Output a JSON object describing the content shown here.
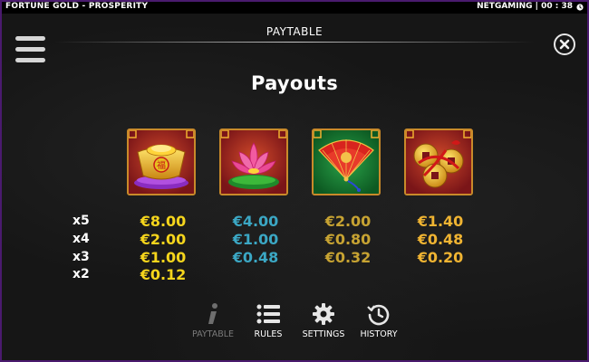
{
  "topbar": {
    "title": "FORTUNE GOLD - PROSPERITY",
    "brand_time": "NETGAMING | 00 : 38"
  },
  "header": {
    "title": "PAYTABLE"
  },
  "page": {
    "heading": "Payouts"
  },
  "symbols": [
    {
      "name": "gold-ingot",
      "char": "福"
    },
    {
      "name": "lotus"
    },
    {
      "name": "fan"
    },
    {
      "name": "coins"
    }
  ],
  "multipliers": [
    "x5",
    "x4",
    "x3",
    "x2"
  ],
  "payouts": {
    "gold_ingot": [
      "€8.00",
      "€2.00",
      "€1.00",
      "€0.12"
    ],
    "lotus": [
      "€4.00",
      "€1.00",
      "€0.48"
    ],
    "fan": [
      "€2.00",
      "€0.80",
      "€0.32"
    ],
    "coins": [
      "€1.40",
      "€0.48",
      "€0.20"
    ]
  },
  "colors": {
    "gold_ingot": "#f5d51c",
    "lotus": "#3ba7c4",
    "fan": "#c7a332",
    "coins": "#f0b432",
    "frame": "#4a1a6e"
  },
  "nav": {
    "paytable": "PAYTABLE",
    "rules": "RULES",
    "settings": "SETTINGS",
    "history": "HISTORY"
  }
}
